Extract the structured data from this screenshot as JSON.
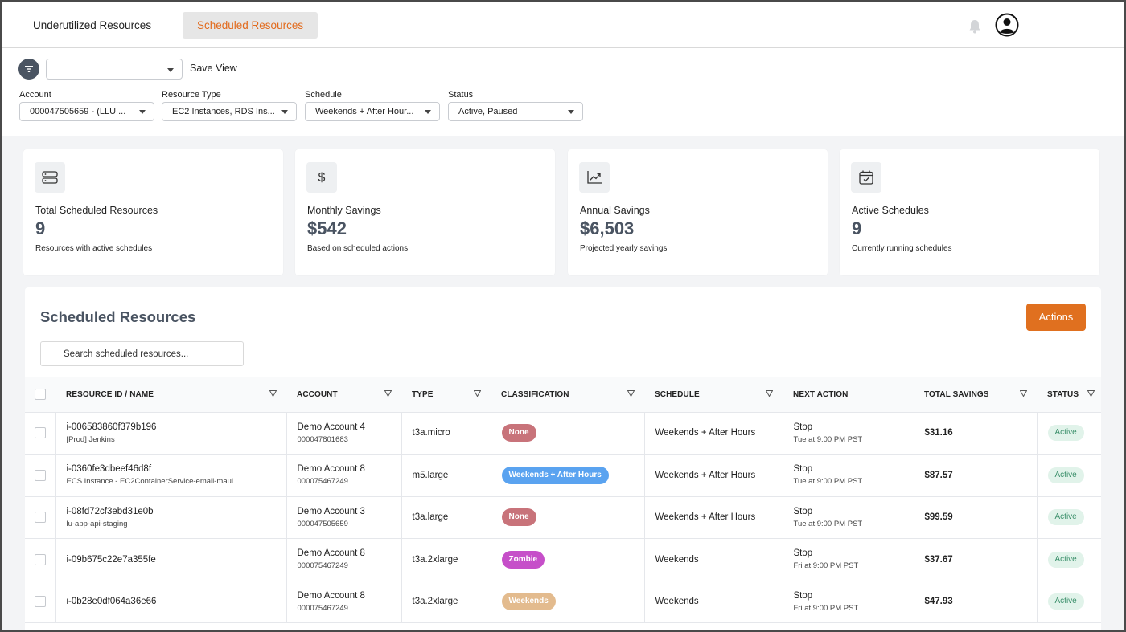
{
  "tabs": [
    {
      "label": "Underutilized Resources"
    },
    {
      "label": "Scheduled Resources"
    }
  ],
  "filters": {
    "save_view_label": "Save View",
    "view_value": "",
    "account": {
      "label": "Account",
      "value": "000047505659 - (LLU ..."
    },
    "resource_type": {
      "label": "Resource Type",
      "value": "EC2 Instances, RDS Ins..."
    },
    "schedule": {
      "label": "Schedule",
      "value": "Weekends + After Hour..."
    },
    "status": {
      "label": "Status",
      "value": "Active, Paused"
    }
  },
  "cards": [
    {
      "icon": "server-icon",
      "title": "Total Scheduled Resources",
      "value": "9",
      "subtitle": "Resources with active schedules"
    },
    {
      "icon": "dollar-icon",
      "title": "Monthly Savings",
      "value": "$542",
      "subtitle": "Based on scheduled actions"
    },
    {
      "icon": "trend-chart-icon",
      "title": "Annual Savings",
      "value": "$6,503",
      "subtitle": "Projected yearly savings"
    },
    {
      "icon": "calendar-check-icon",
      "title": "Active Schedules",
      "value": "9",
      "subtitle": "Currently running schedules"
    }
  ],
  "table_panel": {
    "title": "Scheduled Resources",
    "actions_label": "Actions",
    "search_placeholder": "Search scheduled resources..."
  },
  "columns": [
    "RESOURCE ID / NAME",
    "ACCOUNT",
    "TYPE",
    "CLASSIFICATION",
    "SCHEDULE",
    "NEXT ACTION",
    "TOTAL SAVINGS",
    "STATUS"
  ],
  "rows": [
    {
      "id": "i-006583860f379b196",
      "name": "[Prod] Jenkins",
      "account": "Demo Account 4",
      "account_id": "000047801683",
      "type": "t3a.micro",
      "classification": "None",
      "class_color": "#c8737a",
      "schedule": "Weekends + After Hours",
      "next_action": "Stop",
      "next_time": "Tue at 9:00 PM PST",
      "savings": "$31.16",
      "status": "Active"
    },
    {
      "id": "i-0360fe3dbeef46d8f",
      "name": "ECS Instance - EC2ContainerService-email-maui",
      "account": "Demo Account 8",
      "account_id": "000075467249",
      "type": "m5.large",
      "classification": "Weekends + After Hours",
      "class_color": "#5aa3f0",
      "schedule": "Weekends + After Hours",
      "next_action": "Stop",
      "next_time": "Tue at 9:00 PM PST",
      "savings": "$87.57",
      "status": "Active"
    },
    {
      "id": "i-08fd72cf3ebd31e0b",
      "name": "lu-app-api-staging",
      "account": "Demo Account 3",
      "account_id": "000047505659",
      "type": "t3a.large",
      "classification": "None",
      "class_color": "#c8737a",
      "schedule": "Weekends + After Hours",
      "next_action": "Stop",
      "next_time": "Tue at 9:00 PM PST",
      "savings": "$99.59",
      "status": "Active"
    },
    {
      "id": "i-09b675c22e7a355fe",
      "name": "",
      "account": "Demo Account 8",
      "account_id": "000075467249",
      "type": "t3a.2xlarge",
      "classification": "Zombie",
      "class_color": "#c64fc9",
      "schedule": "Weekends",
      "next_action": "Stop",
      "next_time": "Fri at 9:00 PM PST",
      "savings": "$37.67",
      "status": "Active"
    },
    {
      "id": "i-0b28e0df064a36e66",
      "name": "",
      "account": "Demo Account 8",
      "account_id": "000075467249",
      "type": "t3a.2xlarge",
      "classification": "Weekends",
      "class_color": "#e3bb8e",
      "schedule": "Weekends",
      "next_action": "Stop",
      "next_time": "Fri at 9:00 PM PST",
      "savings": "$47.93",
      "status": "Active"
    }
  ],
  "colors": {
    "accent": "#e0701f",
    "status_green": "#3a8f6a"
  }
}
